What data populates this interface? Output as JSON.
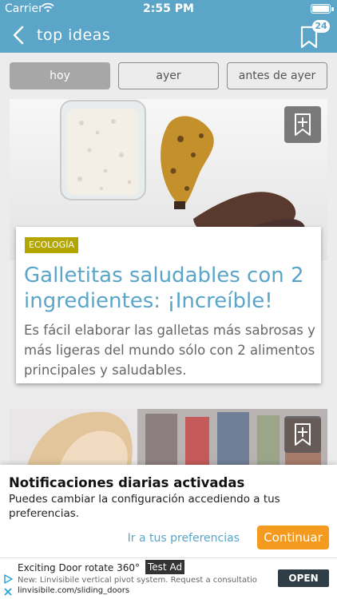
{
  "status_bar": {
    "carrier": "Carrier",
    "time": "2:55 PM"
  },
  "nav": {
    "title": "top ideas",
    "badge_count": "24"
  },
  "tabs": [
    {
      "label": "hoy",
      "active": true
    },
    {
      "label": "ayer",
      "active": false
    },
    {
      "label": "antes de ayer",
      "active": false
    }
  ],
  "article": {
    "category": "ECOLOGÍA",
    "title": "Galletitas saludables con 2 ingredientes: ¡Increíble!",
    "description": "Es fácil elaborar las galletas más sabrosas y más ligeras del mundo sólo con 2 alimentos principales y saludables."
  },
  "notification": {
    "title": "Notificaciones diarias activadas",
    "body": "Puedes cambiar la configuración accediendo a tus preferencias.",
    "link_label": "Ir a tus preferencias",
    "button_label": "Continuar"
  },
  "ad": {
    "title": "Exciting Door rotate 360°",
    "label": "Test Ad",
    "description": "New: Linvisibile vertical pivot system. Request a consultation!",
    "url": "linvisibile.com/sliding_doors",
    "button_label": "OPEN"
  },
  "colors": {
    "accent": "#5aa5c8",
    "category": "#b3a600",
    "cta": "#f39a1f"
  }
}
